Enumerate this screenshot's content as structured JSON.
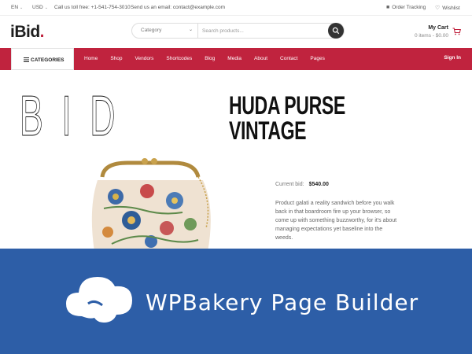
{
  "topbar": {
    "language": "EN",
    "currency": "USD",
    "phone": "Call us toll free: +1-541-754-3010",
    "email": "Send us an email: contact@example.com",
    "order_tracking": "Order Tracking",
    "wishlist": "Wishlist"
  },
  "header": {
    "logo_main": "iBid",
    "logo_dot": ".",
    "category_select": "Category",
    "search_placeholder": "Search products...",
    "cart_title": "My Cart",
    "cart_summary": "0 items - $0.00"
  },
  "nav": {
    "categories_label": "CATEGORIES",
    "links": [
      "Home",
      "Shop",
      "Vendors",
      "Shortcodes",
      "Blog",
      "Media",
      "About",
      "Contact",
      "Pages"
    ],
    "signin": "Sign In"
  },
  "hero": {
    "big_text": "BID",
    "product_title_line1": "HUDA PURSE",
    "product_title_line2": "VINTAGE",
    "current_bid_label": "Current bid:",
    "current_bid_value": "$540.00",
    "description": "Product galati a reality sandwich before you walk back in that boardroom fire up your browser, so come up with something buzzworthy, for it's about managing expectations yet baseline into the weeds."
  },
  "banner": {
    "title": "WPBakery Page Builder"
  },
  "colors": {
    "accent": "#c0233e",
    "banner": "#2d5ea7",
    "dark": "#222222"
  },
  "icons": [
    "chevron-down-icon",
    "truck-icon",
    "heart-icon",
    "search-icon",
    "cart-icon",
    "hamburger-icon",
    "wpbakery-logo-icon"
  ]
}
